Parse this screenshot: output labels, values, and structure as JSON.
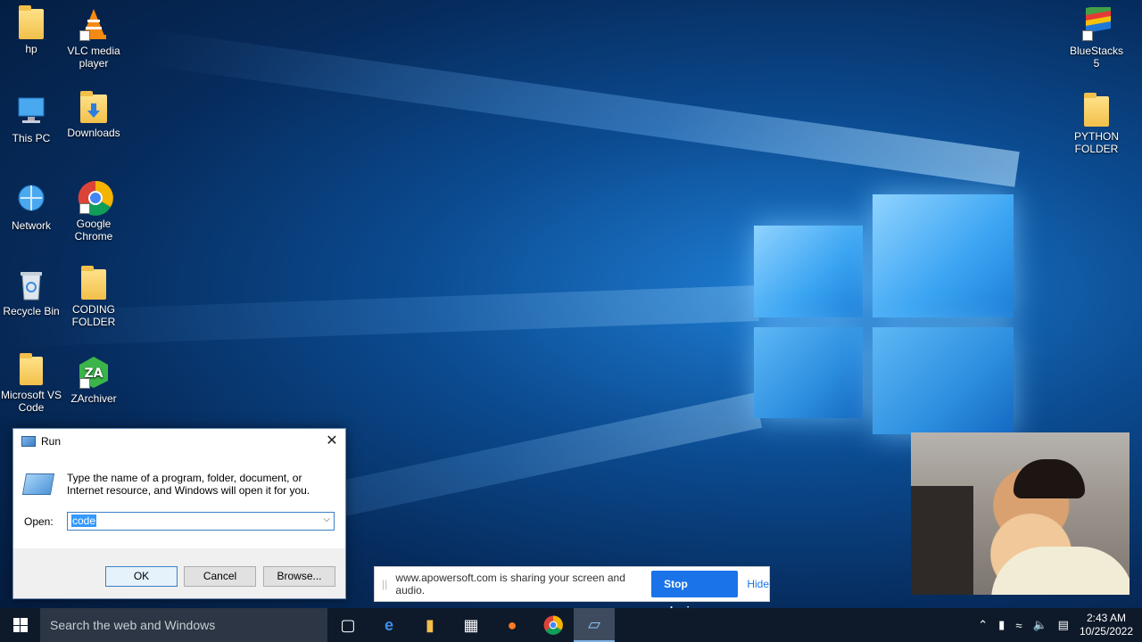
{
  "desktop": {
    "icons_left": [
      {
        "label": "hp",
        "icon": "user-folder-icon"
      },
      {
        "label": "VLC media player",
        "icon": "vlc-icon"
      },
      {
        "label": "This PC",
        "icon": "computer-icon"
      },
      {
        "label": "Downloads",
        "icon": "downloads-folder-icon"
      },
      {
        "label": "Network",
        "icon": "network-icon"
      },
      {
        "label": "Google Chrome",
        "icon": "chrome-icon"
      },
      {
        "label": "Recycle Bin",
        "icon": "recycle-bin-icon"
      },
      {
        "label": "CODING FOLDER",
        "icon": "folder-icon"
      },
      {
        "label": "Microsoft VS Code",
        "icon": "folder-icon"
      },
      {
        "label": "ZArchiver",
        "icon": "zarchiver-icon"
      }
    ],
    "icons_right": [
      {
        "label": "BlueStacks 5",
        "icon": "bluestacks-icon"
      },
      {
        "label": "PYTHON FOLDER",
        "icon": "folder-icon"
      }
    ]
  },
  "run_dialog": {
    "title": "Run",
    "description": "Type the name of a program, folder, document, or Internet resource, and Windows will open it for you.",
    "open_label": "Open:",
    "open_value": "code",
    "ok_label": "OK",
    "cancel_label": "Cancel",
    "browse_label": "Browse..."
  },
  "share_bar": {
    "text": "www.apowersoft.com is sharing your screen and audio.",
    "stop_label": "Stop sharing",
    "hide_label": "Hide"
  },
  "taskbar": {
    "search_placeholder": "Search the web and Windows",
    "apps": [
      "task-view-icon",
      "edge-icon",
      "file-explorer-icon",
      "store-icon",
      "firefox-icon",
      "chrome-icon",
      "run-app-icon"
    ],
    "time": "2:43 AM",
    "date": "10/25/2022"
  }
}
